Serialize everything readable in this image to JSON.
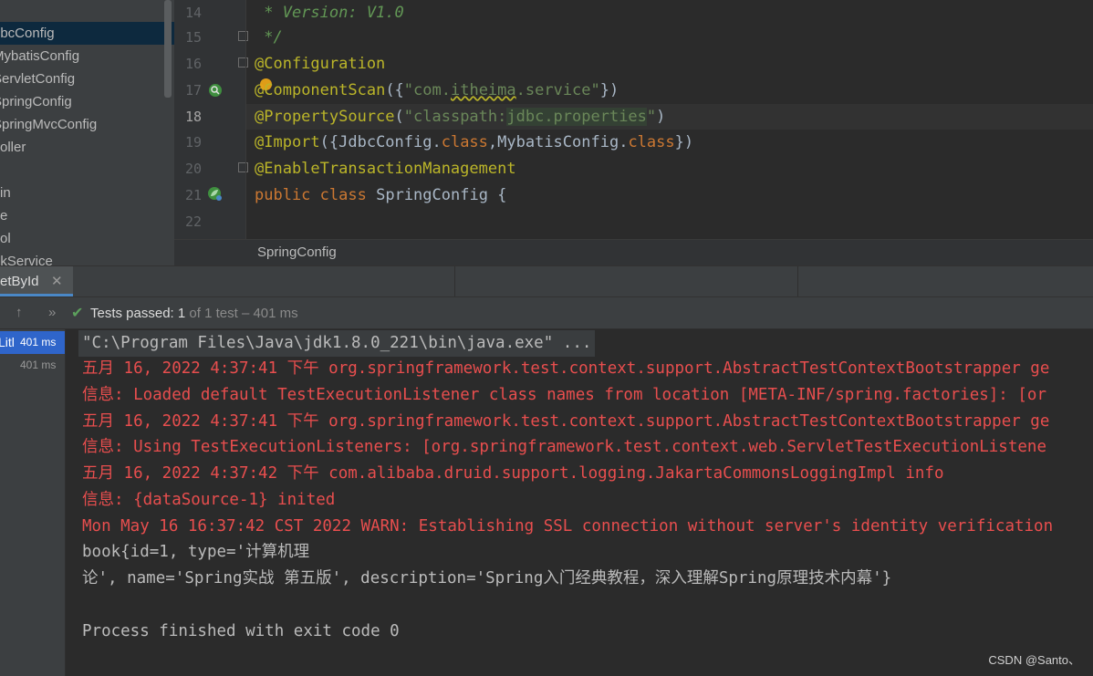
{
  "project_tree": {
    "items": [
      {
        "label": "dbcConfig",
        "selected": true
      },
      {
        "label": "MybatisConfig"
      },
      {
        "label": "ServletConfig"
      },
      {
        "label": "SpringConfig"
      },
      {
        "label": "SpringMvcConfig"
      },
      {
        "label": "oller"
      },
      {
        "label": ""
      },
      {
        "label": "in"
      },
      {
        "label": "e"
      },
      {
        "label": "ol"
      },
      {
        "label": "okService"
      }
    ]
  },
  "editor": {
    "lines": [
      {
        "num": "14"
      },
      {
        "num": "15"
      },
      {
        "num": "16"
      },
      {
        "num": "17"
      },
      {
        "num": "18",
        "active": true
      },
      {
        "num": "19"
      },
      {
        "num": "20"
      },
      {
        "num": "21"
      },
      {
        "num": "22"
      }
    ],
    "code": {
      "l14": " * Version: V1.0",
      "l15": " */",
      "l16": "@Configuration",
      "l17_ann_start": "@",
      "l17_ann_rest": "ComponentScan",
      "l17_open": "({",
      "l17_str_a": "\"com.",
      "l17_str_b": "itheima",
      "l17_str_c": ".service\"",
      "l17_close": "})",
      "l18_ann": "@PropertySource",
      "l18_open": "(",
      "l18_str_a": "\"classpath:",
      "l18_str_b": "jdbc.properties",
      "l18_str_c": "\"",
      "l18_close": ")",
      "l19_ann": "@Import",
      "l19_a": "({JdbcConfig.",
      "l19_kw1": "class",
      "l19_b": ",MybatisConfig.",
      "l19_kw2": "class",
      "l19_c": "})",
      "l20": "@EnableTransactionManagement",
      "l21_kw1": "public",
      "l21_kw2": "class",
      "l21_rest": "SpringConfig {"
    },
    "breadcrumb": "SpringConfig"
  },
  "run_window": {
    "tab_label": "etById",
    "toolbar": {
      "tests_passed_label": "Tests passed:",
      "tests_passed_count": "1",
      "tests_detail": "of 1 test – 401 ms"
    },
    "test_tree": [
      {
        "name": "Litl",
        "time": "401 ms",
        "selected": true
      },
      {
        "name": "",
        "time": "401 ms"
      }
    ],
    "console": {
      "cmd": "\"C:\\Program Files\\Java\\jdk1.8.0_221\\bin\\java.exe\" ...",
      "lines": [
        {
          "text": "五月 16, 2022 4:37:41 下午 org.springframework.test.context.support.AbstractTestContextBootstrapper ge",
          "kind": "err"
        },
        {
          "text": "信息: Loaded default TestExecutionListener class names from location [META-INF/spring.factories]: [or",
          "kind": "err"
        },
        {
          "text": "五月 16, 2022 4:37:41 下午 org.springframework.test.context.support.AbstractTestContextBootstrapper ge",
          "kind": "err"
        },
        {
          "text": "信息: Using TestExecutionListeners: [org.springframework.test.context.web.ServletTestExecutionListene",
          "kind": "err"
        },
        {
          "text": "五月 16, 2022 4:37:42 下午 com.alibaba.druid.support.logging.JakartaCommonsLoggingImpl info",
          "kind": "err"
        },
        {
          "text": "信息: {dataSource-1} inited",
          "kind": "err"
        },
        {
          "text": "Mon May 16 16:37:42 CST 2022 WARN: Establishing SSL connection without server's identity verification",
          "kind": "err"
        },
        {
          "text": "book{id=1, type='计算机理",
          "kind": "out"
        },
        {
          "text": "论', name='Spring实战 第五版', description='Spring入门经典教程，深入理解Spring原理技术内幕'}",
          "kind": "out"
        },
        {
          "text": "",
          "kind": "out"
        },
        {
          "text": "Process finished with exit code 0",
          "kind": "out"
        }
      ]
    }
  },
  "watermark": "CSDN @Santo、"
}
